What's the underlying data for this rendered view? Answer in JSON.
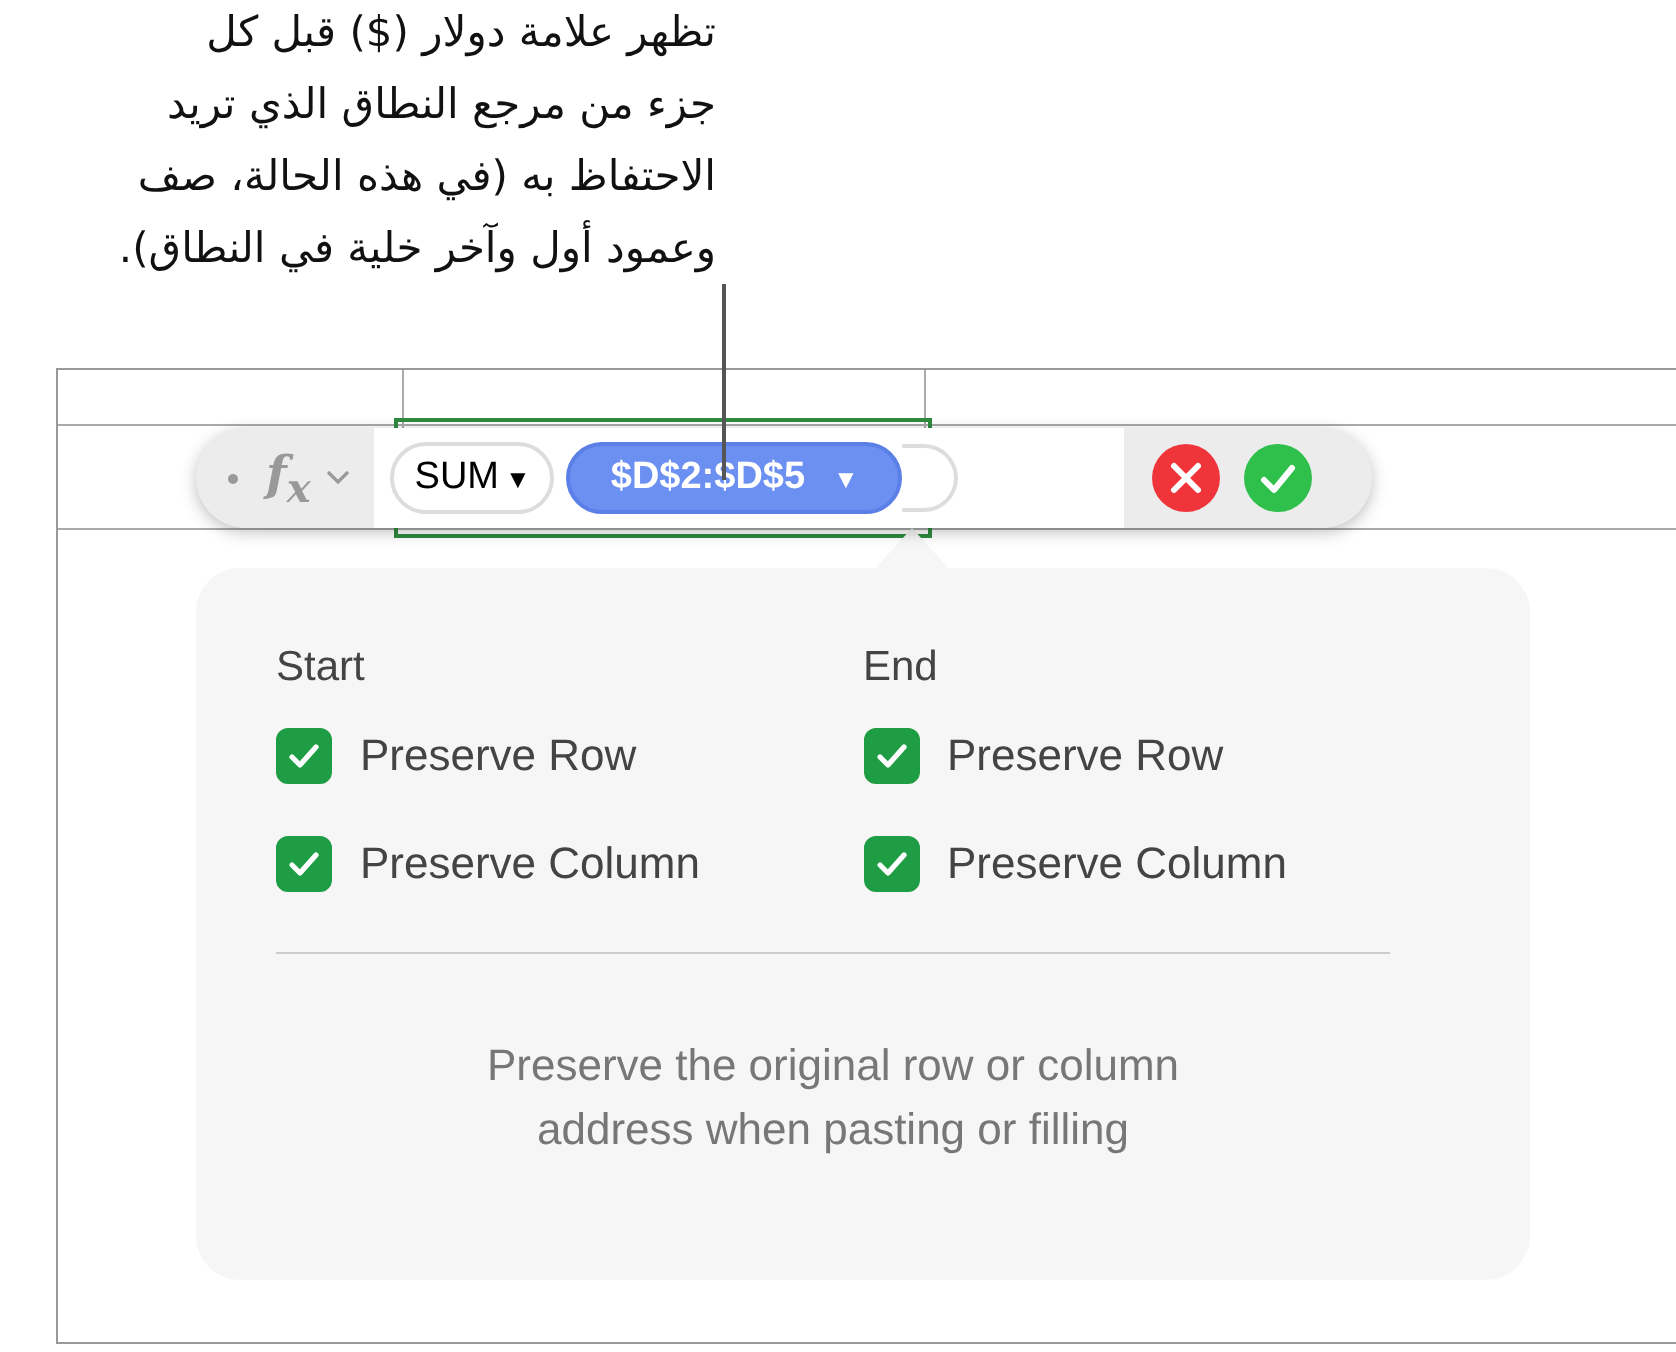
{
  "callout": {
    "text": "تظهر علامة دولار ($) قبل كل\nجزء من مرجع النطاق الذي تريد\nالاحتفاظ به (في هذه الحالة، صف\nوعمود أول وآخر خلية في النطاق)."
  },
  "formula_bar": {
    "fx": "f$_{x}$",
    "function": "SUM",
    "function_caret": "▼",
    "reference": "$D$2:$D$5",
    "reference_caret": "▼"
  },
  "popover": {
    "groups": [
      {
        "heading": "Start",
        "options": [
          {
            "label": "Preserve Row",
            "checked": true
          },
          {
            "label": "Preserve Column",
            "checked": true
          }
        ]
      },
      {
        "heading": "End",
        "options": [
          {
            "label": "Preserve Row",
            "checked": true
          },
          {
            "label": "Preserve Column",
            "checked": true
          }
        ]
      }
    ],
    "description": "Preserve the original row or column\naddress when pasting or filling"
  }
}
